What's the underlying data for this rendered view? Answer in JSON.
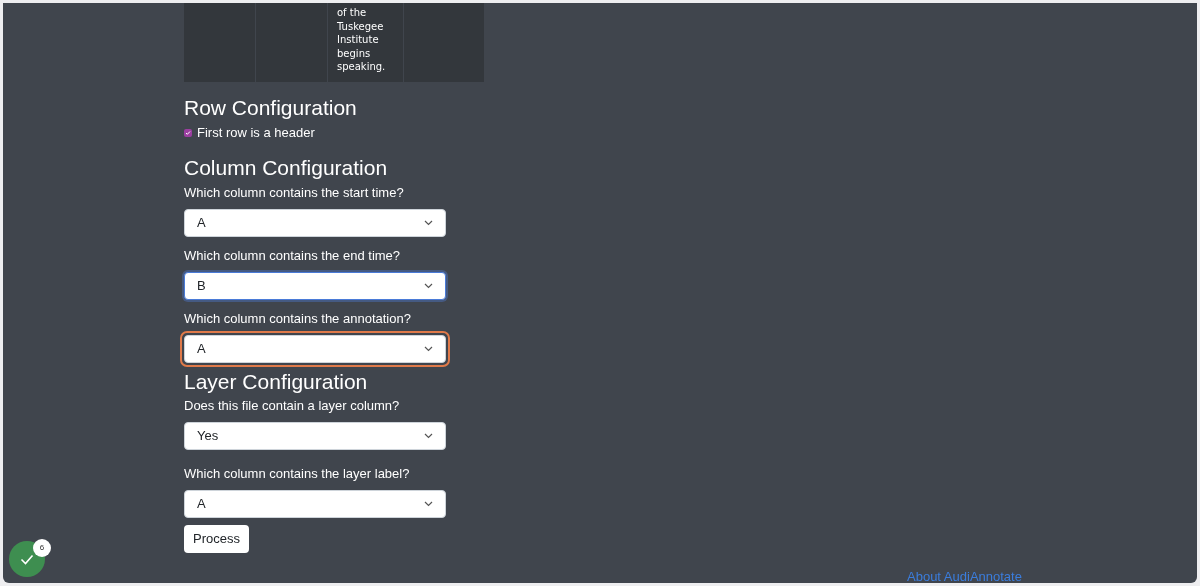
{
  "table": {
    "cells": [
      "",
      "",
      "of the Tuskegee Institute begins speaking.",
      ""
    ]
  },
  "row_configuration": {
    "heading": "Row Configuration",
    "header_checkbox": {
      "label": "First row is a header",
      "checked": true
    }
  },
  "column_configuration": {
    "heading": "Column Configuration",
    "fields": [
      {
        "label": "Which column contains the start time?",
        "value": "A",
        "focused": false,
        "highlighted": false
      },
      {
        "label": "Which column contains the end time?",
        "value": "B",
        "focused": true,
        "highlighted": false
      },
      {
        "label": "Which column contains the annotation?",
        "value": "A",
        "focused": false,
        "highlighted": true
      }
    ]
  },
  "layer_configuration": {
    "heading": "Layer Configuration",
    "fields": [
      {
        "label": "Does this file contain a layer column?",
        "value": "Yes",
        "focused": false,
        "highlighted": false
      },
      {
        "label": "Which column contains the layer label?",
        "value": "A",
        "focused": false,
        "highlighted": false
      }
    ]
  },
  "process_button": "Process",
  "status_badge": {
    "count": "6"
  },
  "footer_link": "About AudiAnnotate"
}
